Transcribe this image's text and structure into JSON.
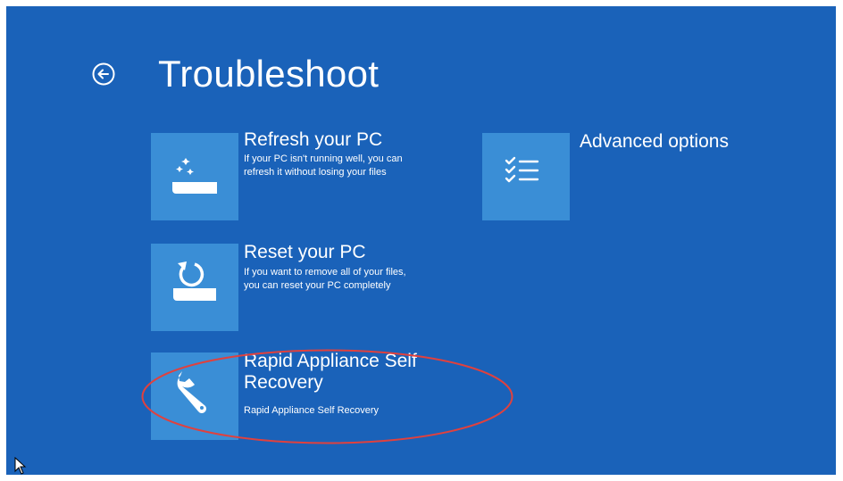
{
  "page": {
    "title": "Troubleshoot",
    "back_icon": "back-arrow-circle-icon"
  },
  "options": [
    {
      "id": "refresh",
      "icon": "refresh-sparkle-icon",
      "title": "Refresh your PC",
      "desc_line1": "If your PC isn't running well, you can",
      "desc_line2": "refresh it without losing your files"
    },
    {
      "id": "reset",
      "icon": "reset-cycle-icon",
      "title": "Reset your PC",
      "desc_line1": "If you want to remove all of your files,",
      "desc_line2": "you can reset your PC completely"
    },
    {
      "id": "rapid",
      "icon": "wrench-icon",
      "title_line1": "Rapid Appliance Self",
      "title_line2": "Recovery",
      "desc_line1": "Rapid Appliance Self Recovery"
    },
    {
      "id": "advanced",
      "icon": "checklist-icon",
      "title": "Advanced options"
    }
  ],
  "colors": {
    "background": "#1a62b9",
    "tile": "#3a8ed6",
    "highlight_ring": "#e0413e"
  }
}
